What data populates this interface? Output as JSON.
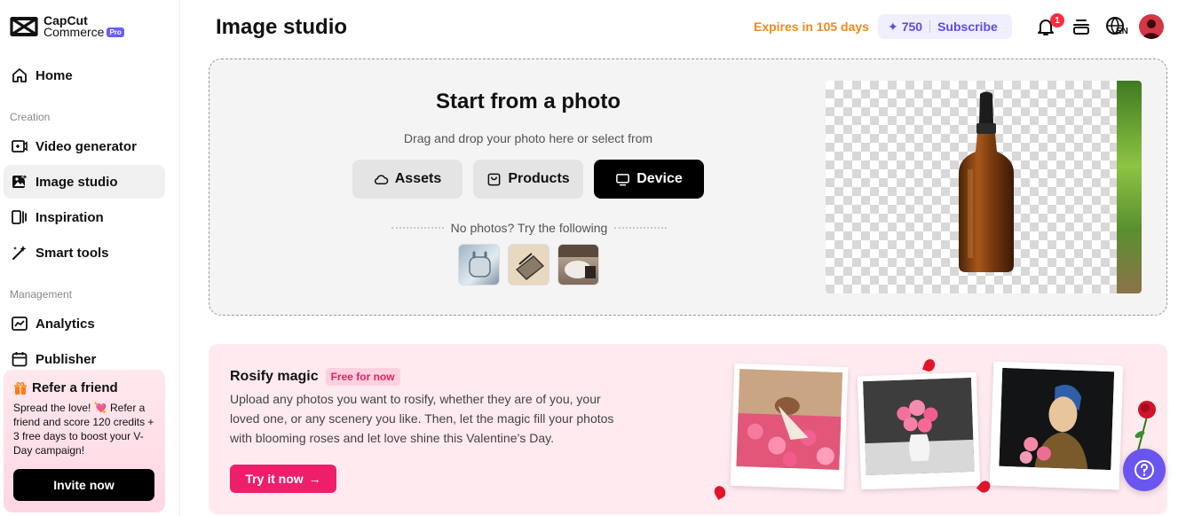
{
  "brand": {
    "line1": "CapCut",
    "line2": "Commerce",
    "badge": "Pro"
  },
  "sidebar": {
    "home": "Home",
    "section_creation": "Creation",
    "creation_items": [
      {
        "label": "Video generator",
        "icon": "video-plus-icon"
      },
      {
        "label": "Image studio",
        "icon": "image-sparkle-icon",
        "active": true
      },
      {
        "label": "Inspiration",
        "icon": "inspiration-icon"
      },
      {
        "label": "Smart tools",
        "icon": "magic-wand-icon"
      }
    ],
    "section_management": "Management",
    "management_items": [
      {
        "label": "Analytics",
        "icon": "analytics-chart-icon"
      },
      {
        "label": "Publisher",
        "icon": "calendar-icon"
      }
    ],
    "refer": {
      "title": "Refer a friend",
      "body": "Spread the love! 💘 Refer a friend and score 120 credits + 3 free days to boost your V-Day campaign!",
      "button": "Invite now"
    }
  },
  "header": {
    "title": "Image studio",
    "expires": "Expires in 105 days",
    "credits": "750",
    "subscribe": "Subscribe",
    "notification_count": "1",
    "language": "EN"
  },
  "upload": {
    "title": "Start from a photo",
    "subtitle": "Drag and drop your photo here or select from",
    "buttons": {
      "assets": "Assets",
      "products": "Products",
      "device": "Device"
    },
    "try_label": "No photos? Try the following",
    "samples": [
      "earbuds-sample",
      "compact-sample",
      "chair-sample"
    ]
  },
  "rosify": {
    "title": "Rosify magic",
    "badge": "Free for now",
    "description": "Upload any photos you want to rosify, whether they are of you, your loved one, or any scenery you like. Then, let the magic fill your photos with blooming roses and let love shine this Valentine’s Day.",
    "button": "Try it now"
  },
  "colors": {
    "accent_orange": "#f08a1c",
    "accent_purple": "#5a4de6",
    "pink_cta": "#ee1f6a",
    "help_purple": "#6a55f0"
  }
}
